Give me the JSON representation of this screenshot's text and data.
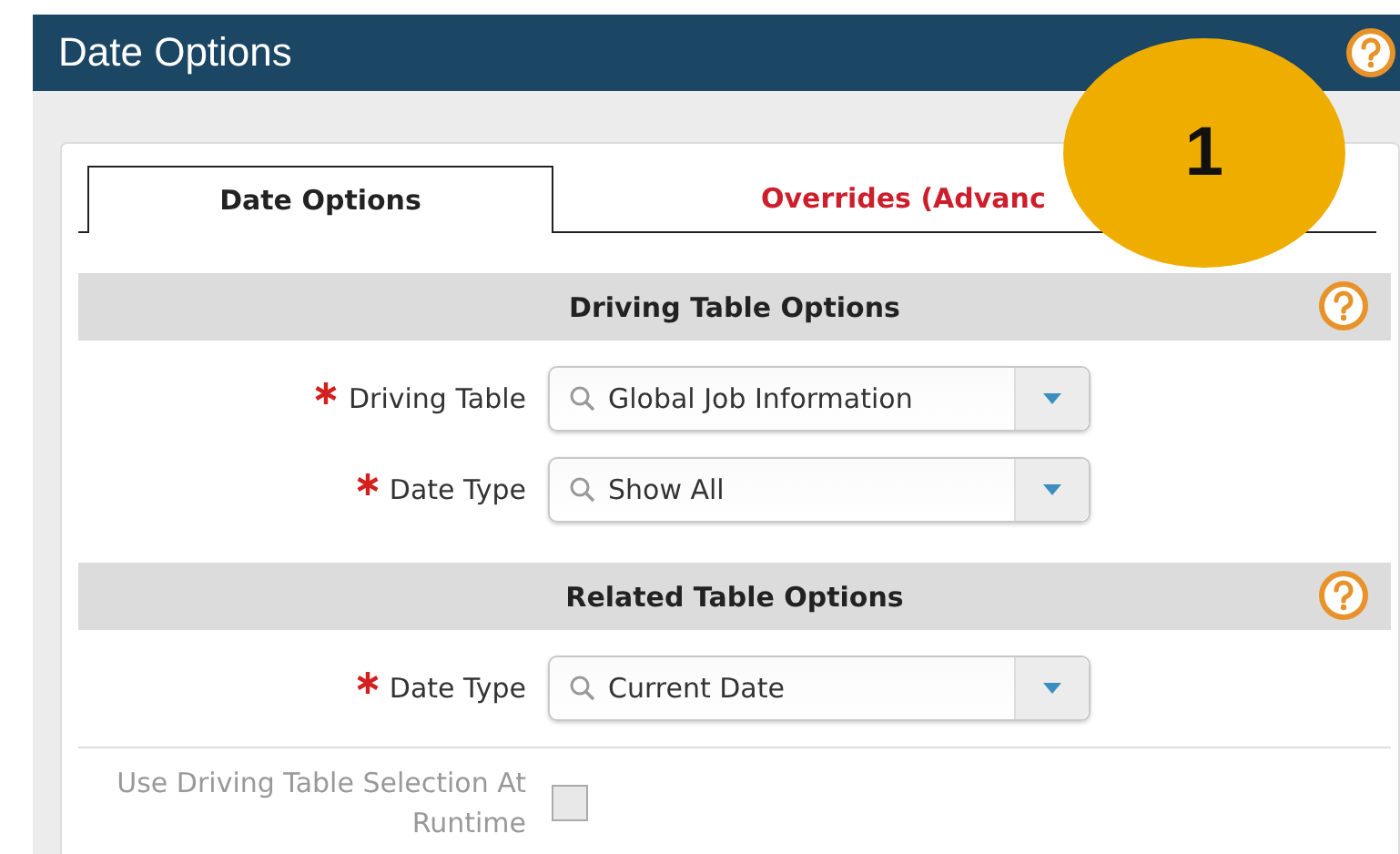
{
  "header": {
    "title": "Date Options"
  },
  "tabs": [
    {
      "label": "Date Options",
      "selected": true
    },
    {
      "label": "Overrides (Advanc",
      "selected": false
    }
  ],
  "badge": {
    "label": "1"
  },
  "sections": [
    {
      "title": "Driving Table Options",
      "rows": [
        {
          "kind": "select",
          "label": "Driving Table",
          "required": true,
          "value": "Global Job Information"
        },
        {
          "kind": "select",
          "label": "Date Type",
          "required": true,
          "value": "Show All"
        }
      ]
    },
    {
      "title": "Related Table Options",
      "rows": [
        {
          "kind": "select",
          "label": "Date Type",
          "required": true,
          "value": "Current Date"
        },
        {
          "kind": "checkbox",
          "label": "Use Driving Table Selection At Runtime",
          "checked": false,
          "disabled": true
        }
      ]
    }
  ]
}
